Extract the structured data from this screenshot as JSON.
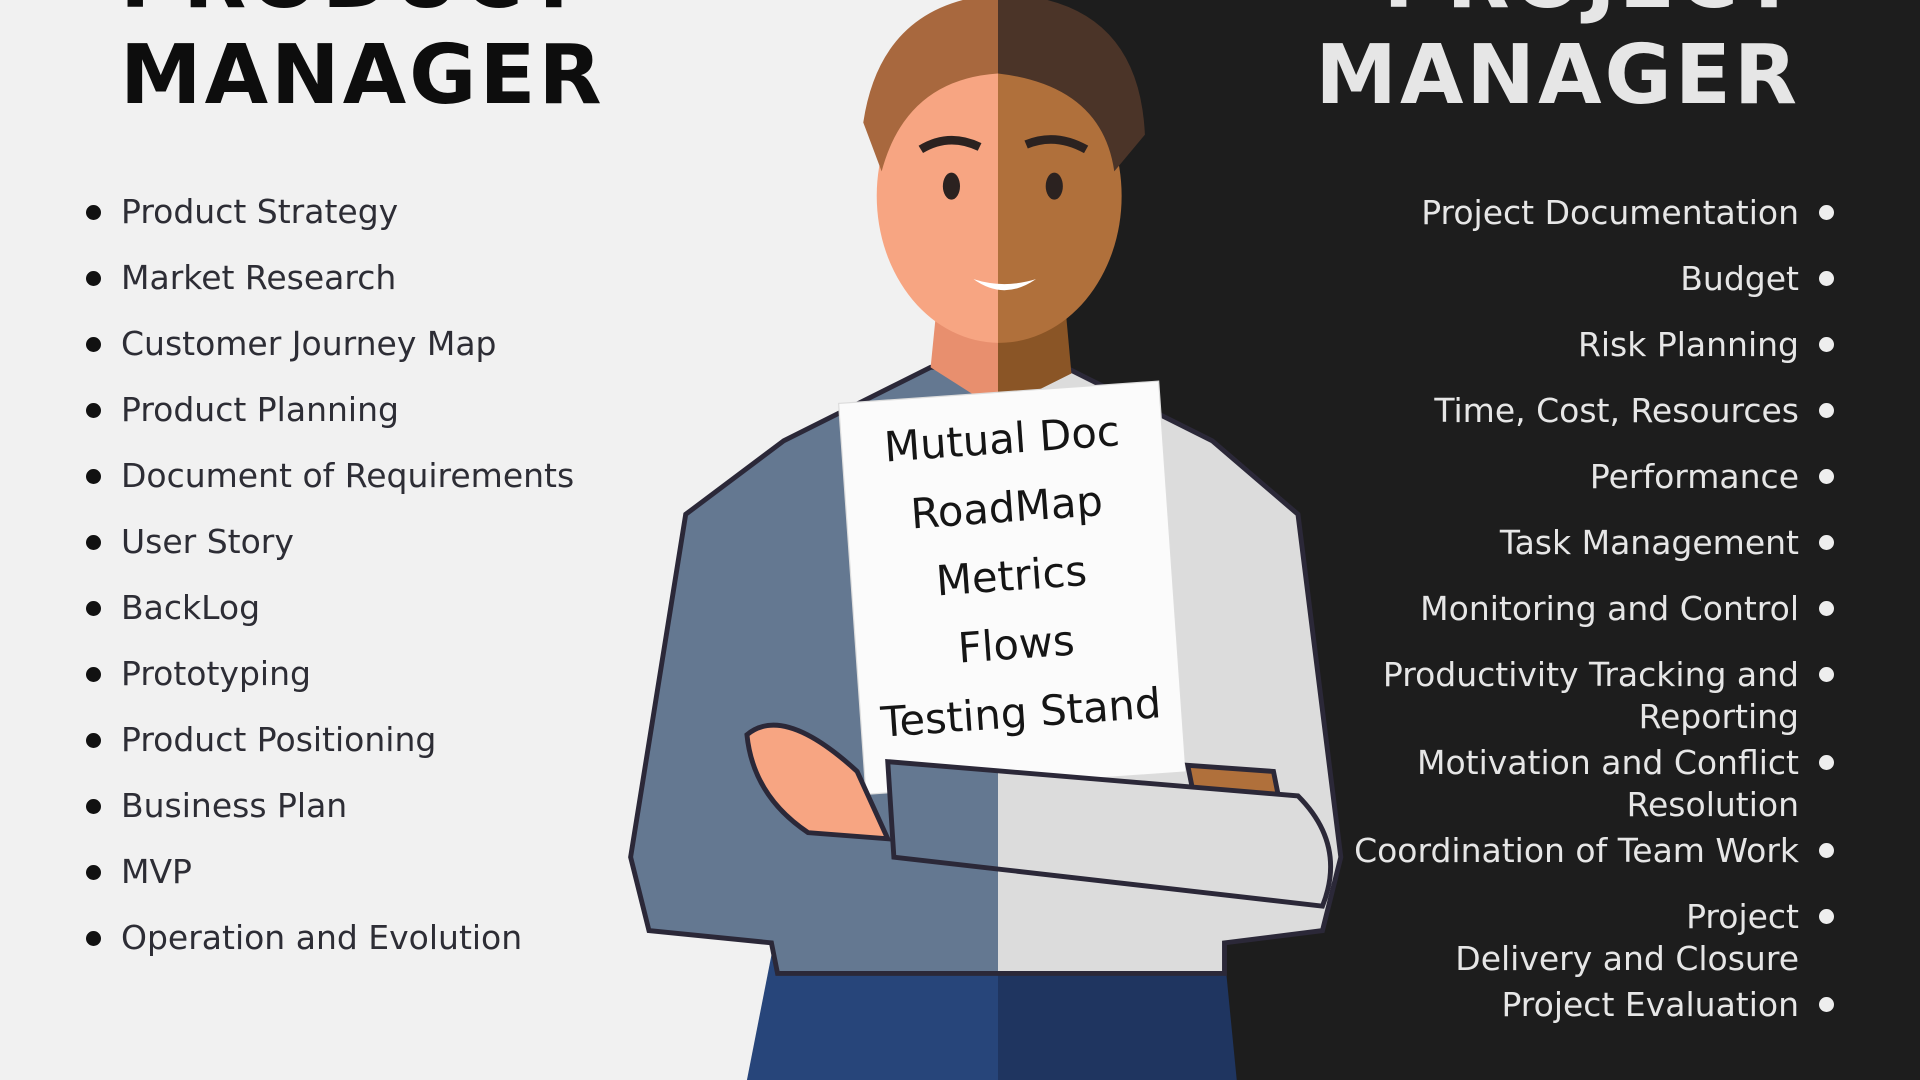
{
  "left": {
    "title_line1": "PRODUCT",
    "title_line2": "MANAGER",
    "items": [
      "Product Strategy",
      "Market Research",
      "Customer Journey Map",
      "Product Planning",
      "Document of Requirements",
      "User Story",
      "BackLog",
      "Prototyping",
      "Product Positioning",
      "Business Plan",
      "MVP",
      "Operation and Evolution"
    ]
  },
  "right": {
    "title_line1": "PROJECT",
    "title_line2": "MANAGER",
    "items": [
      [
        "Project Documentation"
      ],
      [
        "Budget"
      ],
      [
        "Risk Planning"
      ],
      [
        "Time, Cost, Resources"
      ],
      [
        "Performance"
      ],
      [
        "Task Management"
      ],
      [
        "Monitoring and Control"
      ],
      [
        "Productivity Tracking and",
        "Reporting"
      ],
      [
        "Motivation and Conflict",
        "Resolution"
      ],
      [
        "Coordination of Team Work"
      ],
      [
        "Project",
        "Delivery and Closure"
      ],
      [
        "Project Evaluation"
      ]
    ]
  },
  "document": {
    "lines": [
      "Mutual Doc",
      "RoadMap",
      "Metrics",
      "Flows",
      "Testing Stand"
    ]
  },
  "colors": {
    "light_bg": "#f1f1f1",
    "dark_bg": "#1d1d1d",
    "shirt_left": "#647891",
    "shirt_right": "#dcdcdc",
    "jeans": "#27457a"
  }
}
